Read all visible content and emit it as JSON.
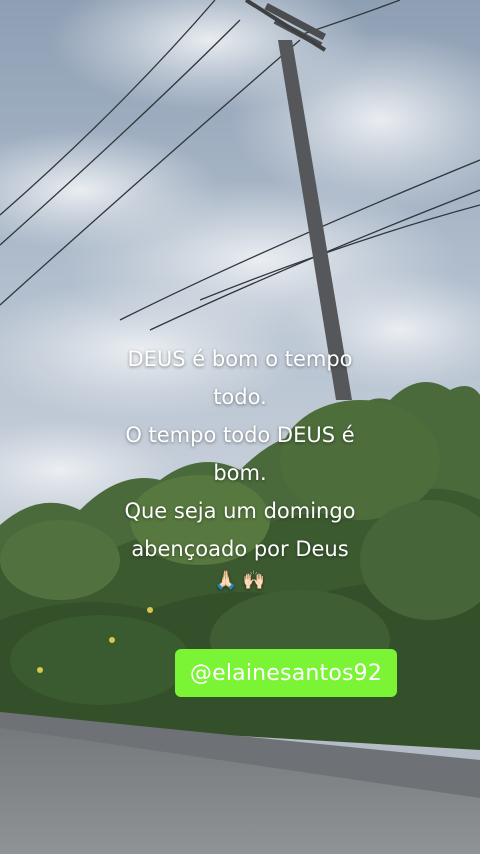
{
  "story": {
    "caption_lines": [
      "DEUS é bom o tempo",
      "todo.",
      "O tempo todo DEUS é",
      "bom.",
      "Que seja um domingo",
      "abençoado por Deus"
    ],
    "emojis": "🙏🏻 🙌🏻",
    "mention": "@elainesantos92"
  },
  "colors": {
    "mention_background": "#7cf436",
    "sky": "#b6c3d2",
    "foliage": "#3e5a32",
    "road": "#85898c"
  }
}
